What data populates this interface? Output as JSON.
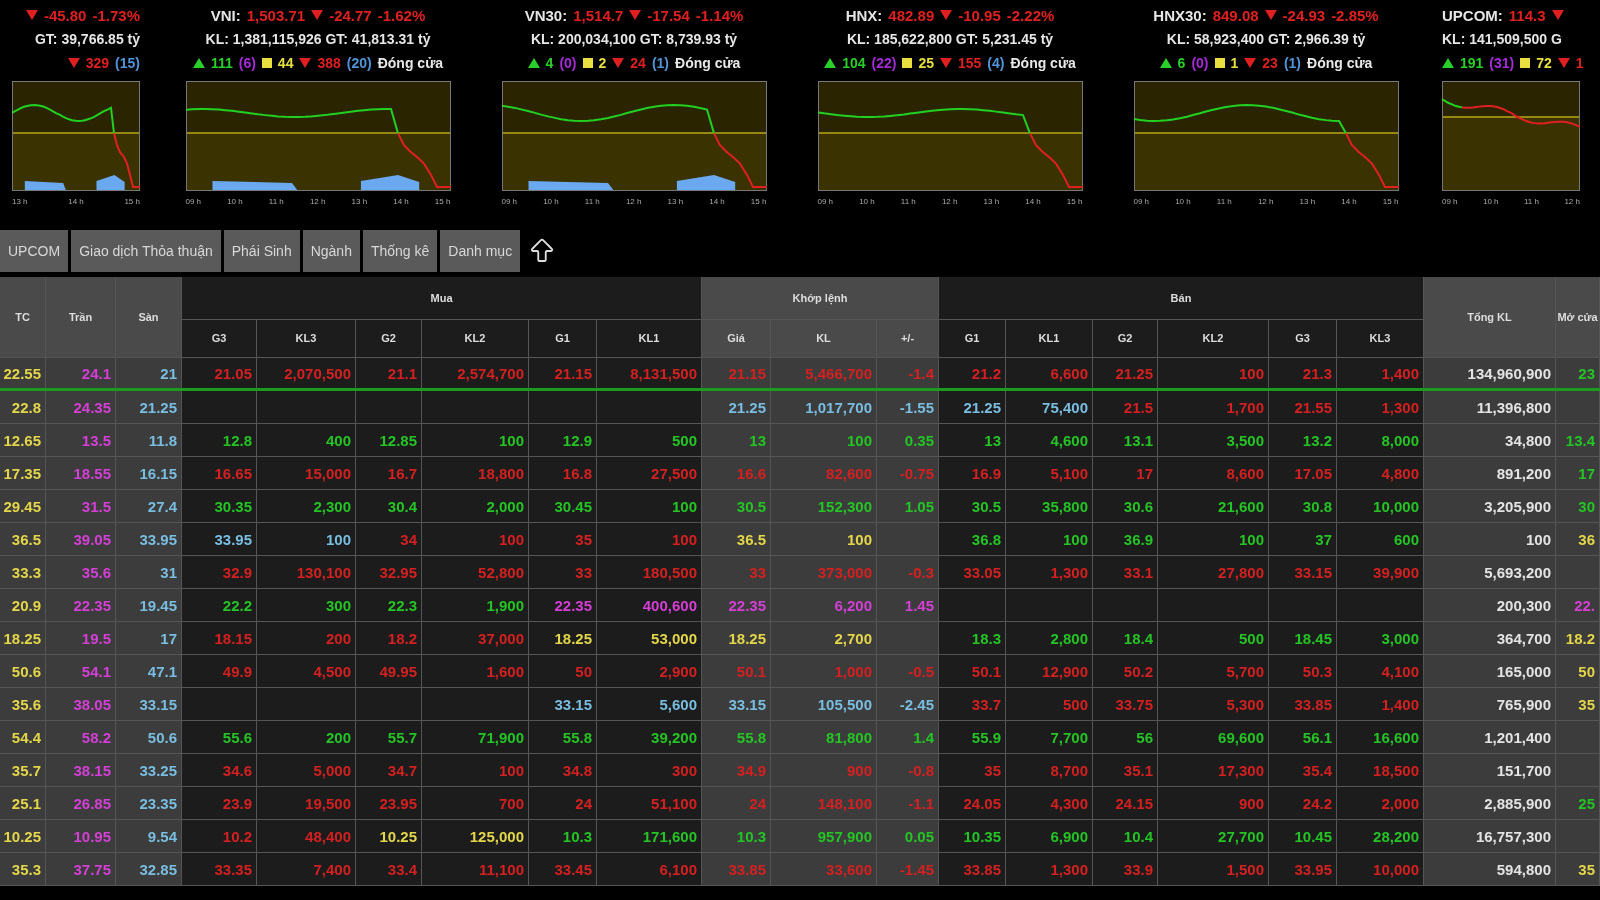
{
  "indices": [
    {
      "falling": true,
      "change": "-45.80",
      "percent": "-1.73%",
      "volume": "GT: 39,766.85 tỷ",
      "counts": [
        {
          "kind": "down",
          "text": "329"
        },
        {
          "kind": "floor",
          "text": "(15)"
        }
      ],
      "ticks": [
        "13 h",
        "14 h",
        "15 h"
      ]
    },
    {
      "name": "VNI:",
      "value": "1,503.71",
      "falling": true,
      "change": "-24.77",
      "percent": "-1.62%",
      "volume": "KL: 1,381,115,926 GT: 41,813.31 tỷ",
      "counts": [
        {
          "kind": "up",
          "text": "111"
        },
        {
          "kind": "ceil",
          "text": "(6)"
        },
        {
          "kind": "ref",
          "text": "44"
        },
        {
          "kind": "down",
          "text": "388"
        },
        {
          "kind": "floor",
          "text": "(20)"
        },
        {
          "kind": "status",
          "text": "Đóng cửa"
        }
      ],
      "ticks": [
        "09 h",
        "10 h",
        "11 h",
        "12 h",
        "13 h",
        "14 h",
        "15 h"
      ]
    },
    {
      "name": "VN30:",
      "value": "1,514.7",
      "falling": true,
      "change": "-17.54",
      "percent": "-1.14%",
      "volume": "KL: 200,034,100 GT: 8,739.93 tỷ",
      "counts": [
        {
          "kind": "up",
          "text": "4"
        },
        {
          "kind": "ceil",
          "text": "(0)"
        },
        {
          "kind": "ref",
          "text": "2"
        },
        {
          "kind": "down",
          "text": "24"
        },
        {
          "kind": "floor",
          "text": "(1)"
        },
        {
          "kind": "status",
          "text": "Đóng cửa"
        }
      ],
      "ticks": [
        "09 h",
        "10 h",
        "11 h",
        "12 h",
        "13 h",
        "14 h",
        "15 h"
      ]
    },
    {
      "name": "HNX:",
      "value": "482.89",
      "falling": true,
      "change": "-10.95",
      "percent": "-2.22%",
      "volume": "KL: 185,622,800 GT: 5,231.45 tỷ",
      "counts": [
        {
          "kind": "up",
          "text": "104"
        },
        {
          "kind": "ceil",
          "text": "(22)"
        },
        {
          "kind": "ref",
          "text": "25"
        },
        {
          "kind": "down",
          "text": "155"
        },
        {
          "kind": "floor",
          "text": "(4)"
        },
        {
          "kind": "status",
          "text": "Đóng cửa"
        }
      ],
      "ticks": [
        "09 h",
        "10 h",
        "11 h",
        "12 h",
        "13 h",
        "14 h",
        "15 h"
      ]
    },
    {
      "name": "HNX30:",
      "value": "849.08",
      "falling": true,
      "change": "-24.93",
      "percent": "-2.85%",
      "volume": "KL: 58,923,400 GT: 2,966.39 tỷ",
      "counts": [
        {
          "kind": "up",
          "text": "6"
        },
        {
          "kind": "ceil",
          "text": "(0)"
        },
        {
          "kind": "ref",
          "text": "1"
        },
        {
          "kind": "down",
          "text": "23"
        },
        {
          "kind": "floor",
          "text": "(1)"
        },
        {
          "kind": "status",
          "text": "Đóng cửa"
        }
      ],
      "ticks": [
        "09 h",
        "10 h",
        "11 h",
        "12 h",
        "13 h",
        "14 h",
        "15 h"
      ]
    },
    {
      "name": "UPCOM:",
      "value": "114.3",
      "falling": true,
      "volume": "KL: 141,509,500 G",
      "counts": [
        {
          "kind": "up",
          "text": "191"
        },
        {
          "kind": "ceil",
          "text": "(31)"
        },
        {
          "kind": "ref",
          "text": "72"
        },
        {
          "kind": "down",
          "text": "1"
        }
      ],
      "ticks": [
        "09 h",
        "10 h",
        "11 h",
        "12 h"
      ]
    }
  ],
  "tabs": [
    "UPCOM",
    "Giao dịch Thỏa thuận",
    "Phái Sinh",
    "Ngành",
    "Thống kê",
    "Danh mục"
  ],
  "table": {
    "header": [
      {
        "label": "TC"
      },
      {
        "label": "Trần"
      },
      {
        "label": "Sàn"
      },
      {
        "label": "Mua",
        "columns": [
          "G3",
          "KL3",
          "G2",
          "KL2",
          "G1",
          "KL1"
        ]
      },
      {
        "label": "Khớp lệnh",
        "columns": [
          "Giá",
          "KL",
          "+/-"
        ]
      },
      {
        "label": "Bán",
        "columns": [
          "G1",
          "KL1",
          "G2",
          "KL2",
          "G3",
          "KL3"
        ]
      },
      {
        "label": "Tổng KL"
      },
      {
        "label": "Mở cửa"
      }
    ],
    "rows": [
      {
        "selected": true,
        "cells": [
          {
            "text": "22.55",
            "kind": "ref"
          },
          {
            "text": "24.1",
            "kind": "ceil"
          },
          {
            "text": "21",
            "kind": "floor"
          },
          {
            "text": "21.05",
            "kind": "down"
          },
          {
            "text": "2,070,500",
            "kind": "down"
          },
          {
            "text": "21.1",
            "kind": "down"
          },
          {
            "text": "2,574,700",
            "kind": "down"
          },
          {
            "text": "21.15",
            "kind": "down"
          },
          {
            "text": "8,131,500",
            "kind": "down"
          },
          {
            "text": "21.15",
            "kind": "down"
          },
          {
            "text": "5,466,700",
            "kind": "down"
          },
          {
            "text": "-1.4",
            "kind": "down"
          },
          {
            "text": "21.2",
            "kind": "down"
          },
          {
            "text": "6,600",
            "kind": "down"
          },
          {
            "text": "21.25",
            "kind": "down"
          },
          {
            "text": "100",
            "kind": "down"
          },
          {
            "text": "21.3",
            "kind": "down"
          },
          {
            "text": "1,400",
            "kind": "down"
          },
          {
            "text": "134,960,900",
            "kind": "white"
          },
          {
            "text": "23",
            "kind": "up"
          }
        ]
      },
      {
        "selected": false,
        "cells": [
          {
            "text": "22.8",
            "kind": "ref"
          },
          {
            "text": "24.35",
            "kind": "ceil"
          },
          {
            "text": "21.25",
            "kind": "floor"
          },
          {
            "kind": "empty"
          },
          {
            "kind": "empty"
          },
          {
            "kind": "empty"
          },
          {
            "kind": "empty"
          },
          {
            "kind": "empty"
          },
          {
            "kind": "empty"
          },
          {
            "text": "21.25",
            "kind": "floor"
          },
          {
            "text": "1,017,700",
            "kind": "floor"
          },
          {
            "text": "-1.55",
            "kind": "floor"
          },
          {
            "text": "21.25",
            "kind": "floor"
          },
          {
            "text": "75,400",
            "kind": "floor"
          },
          {
            "text": "21.5",
            "kind": "down"
          },
          {
            "text": "1,700",
            "kind": "down"
          },
          {
            "text": "21.55",
            "kind": "down"
          },
          {
            "text": "1,300",
            "kind": "down"
          },
          {
            "text": "11,396,800",
            "kind": "white"
          },
          {
            "kind": "empty"
          }
        ]
      },
      {
        "selected": false,
        "cells": [
          {
            "text": "12.65",
            "kind": "ref"
          },
          {
            "text": "13.5",
            "kind": "ceil"
          },
          {
            "text": "11.8",
            "kind": "floor"
          },
          {
            "text": "12.8",
            "kind": "up"
          },
          {
            "text": "400",
            "kind": "up"
          },
          {
            "text": "12.85",
            "kind": "up"
          },
          {
            "text": "100",
            "kind": "up"
          },
          {
            "text": "12.9",
            "kind": "up"
          },
          {
            "text": "500",
            "kind": "up"
          },
          {
            "text": "13",
            "kind": "up"
          },
          {
            "text": "100",
            "kind": "up"
          },
          {
            "text": "0.35",
            "kind": "up"
          },
          {
            "text": "13",
            "kind": "up"
          },
          {
            "text": "4,600",
            "kind": "up"
          },
          {
            "text": "13.1",
            "kind": "up"
          },
          {
            "text": "3,500",
            "kind": "up"
          },
          {
            "text": "13.2",
            "kind": "up"
          },
          {
            "text": "8,000",
            "kind": "up"
          },
          {
            "text": "34,800",
            "kind": "white"
          },
          {
            "text": "13.4",
            "kind": "up"
          }
        ]
      },
      {
        "selected": false,
        "cells": [
          {
            "text": "17.35",
            "kind": "ref"
          },
          {
            "text": "18.55",
            "kind": "ceil"
          },
          {
            "text": "16.15",
            "kind": "floor"
          },
          {
            "text": "16.65",
            "kind": "down"
          },
          {
            "text": "15,000",
            "kind": "down"
          },
          {
            "text": "16.7",
            "kind": "down"
          },
          {
            "text": "18,800",
            "kind": "down"
          },
          {
            "text": "16.8",
            "kind": "down"
          },
          {
            "text": "27,500",
            "kind": "down"
          },
          {
            "text": "16.6",
            "kind": "down"
          },
          {
            "text": "82,600",
            "kind": "down"
          },
          {
            "text": "-0.75",
            "kind": "down"
          },
          {
            "text": "16.9",
            "kind": "down"
          },
          {
            "text": "5,100",
            "kind": "down"
          },
          {
            "text": "17",
            "kind": "down"
          },
          {
            "text": "8,600",
            "kind": "down"
          },
          {
            "text": "17.05",
            "kind": "down"
          },
          {
            "text": "4,800",
            "kind": "down"
          },
          {
            "text": "891,200",
            "kind": "white"
          },
          {
            "text": "17",
            "kind": "up"
          }
        ]
      },
      {
        "selected": false,
        "cells": [
          {
            "text": "29.45",
            "kind": "ref"
          },
          {
            "text": "31.5",
            "kind": "ceil"
          },
          {
            "text": "27.4",
            "kind": "floor"
          },
          {
            "text": "30.35",
            "kind": "up"
          },
          {
            "text": "2,300",
            "kind": "up"
          },
          {
            "text": "30.4",
            "kind": "up"
          },
          {
            "text": "2,000",
            "kind": "up"
          },
          {
            "text": "30.45",
            "kind": "up"
          },
          {
            "text": "100",
            "kind": "up"
          },
          {
            "text": "30.5",
            "kind": "up"
          },
          {
            "text": "152,300",
            "kind": "up"
          },
          {
            "text": "1.05",
            "kind": "up"
          },
          {
            "text": "30.5",
            "kind": "up"
          },
          {
            "text": "35,800",
            "kind": "up"
          },
          {
            "text": "30.6",
            "kind": "up"
          },
          {
            "text": "21,600",
            "kind": "up"
          },
          {
            "text": "30.8",
            "kind": "up"
          },
          {
            "text": "10,000",
            "kind": "up"
          },
          {
            "text": "3,205,900",
            "kind": "white"
          },
          {
            "text": "30",
            "kind": "up"
          }
        ]
      },
      {
        "selected": false,
        "cells": [
          {
            "text": "36.5",
            "kind": "ref"
          },
          {
            "text": "39.05",
            "kind": "ceil"
          },
          {
            "text": "33.95",
            "kind": "floor"
          },
          {
            "text": "33.95",
            "kind": "floor"
          },
          {
            "text": "100",
            "kind": "floor"
          },
          {
            "text": "34",
            "kind": "down"
          },
          {
            "text": "100",
            "kind": "down"
          },
          {
            "text": "35",
            "kind": "down"
          },
          {
            "text": "100",
            "kind": "down"
          },
          {
            "text": "36.5",
            "kind": "ref"
          },
          {
            "text": "100",
            "kind": "ref"
          },
          {
            "kind": "empty"
          },
          {
            "text": "36.8",
            "kind": "up"
          },
          {
            "text": "100",
            "kind": "up"
          },
          {
            "text": "36.9",
            "kind": "up"
          },
          {
            "text": "100",
            "kind": "up"
          },
          {
            "text": "37",
            "kind": "up"
          },
          {
            "text": "600",
            "kind": "up"
          },
          {
            "text": "100",
            "kind": "white"
          },
          {
            "text": "36",
            "kind": "ref"
          }
        ]
      },
      {
        "selected": false,
        "cells": [
          {
            "text": "33.3",
            "kind": "ref"
          },
          {
            "text": "35.6",
            "kind": "ceil"
          },
          {
            "text": "31",
            "kind": "floor"
          },
          {
            "text": "32.9",
            "kind": "down"
          },
          {
            "text": "130,100",
            "kind": "down"
          },
          {
            "text": "32.95",
            "kind": "down"
          },
          {
            "text": "52,800",
            "kind": "down"
          },
          {
            "text": "33",
            "kind": "down"
          },
          {
            "text": "180,500",
            "kind": "down"
          },
          {
            "text": "33",
            "kind": "down"
          },
          {
            "text": "373,000",
            "kind": "down"
          },
          {
            "text": "-0.3",
            "kind": "down"
          },
          {
            "text": "33.05",
            "kind": "down"
          },
          {
            "text": "1,300",
            "kind": "down"
          },
          {
            "text": "33.1",
            "kind": "down"
          },
          {
            "text": "27,800",
            "kind": "down"
          },
          {
            "text": "33.15",
            "kind": "down"
          },
          {
            "text": "39,900",
            "kind": "down"
          },
          {
            "text": "5,693,200",
            "kind": "white"
          },
          {
            "kind": "empty"
          }
        ]
      },
      {
        "selected": false,
        "cells": [
          {
            "text": "20.9",
            "kind": "ref"
          },
          {
            "text": "22.35",
            "kind": "ceil"
          },
          {
            "text": "19.45",
            "kind": "floor"
          },
          {
            "text": "22.2",
            "kind": "up"
          },
          {
            "text": "300",
            "kind": "up"
          },
          {
            "text": "22.3",
            "kind": "up"
          },
          {
            "text": "1,900",
            "kind": "up"
          },
          {
            "text": "22.35",
            "kind": "ceil"
          },
          {
            "text": "400,600",
            "kind": "ceil"
          },
          {
            "text": "22.35",
            "kind": "ceil"
          },
          {
            "text": "6,200",
            "kind": "ceil"
          },
          {
            "text": "1.45",
            "kind": "ceil"
          },
          {
            "kind": "empty"
          },
          {
            "kind": "empty"
          },
          {
            "kind": "empty"
          },
          {
            "kind": "empty"
          },
          {
            "kind": "empty"
          },
          {
            "kind": "empty"
          },
          {
            "text": "200,300",
            "kind": "white"
          },
          {
            "text": "22.",
            "kind": "ceil"
          }
        ]
      },
      {
        "selected": false,
        "cells": [
          {
            "text": "18.25",
            "kind": "ref"
          },
          {
            "text": "19.5",
            "kind": "ceil"
          },
          {
            "text": "17",
            "kind": "floor"
          },
          {
            "text": "18.15",
            "kind": "down"
          },
          {
            "text": "200",
            "kind": "down"
          },
          {
            "text": "18.2",
            "kind": "down"
          },
          {
            "text": "37,000",
            "kind": "down"
          },
          {
            "text": "18.25",
            "kind": "ref"
          },
          {
            "text": "53,000",
            "kind": "ref"
          },
          {
            "text": "18.25",
            "kind": "ref"
          },
          {
            "text": "2,700",
            "kind": "ref"
          },
          {
            "kind": "empty"
          },
          {
            "text": "18.3",
            "kind": "up"
          },
          {
            "text": "2,800",
            "kind": "up"
          },
          {
            "text": "18.4",
            "kind": "up"
          },
          {
            "text": "500",
            "kind": "up"
          },
          {
            "text": "18.45",
            "kind": "up"
          },
          {
            "text": "3,000",
            "kind": "up"
          },
          {
            "text": "364,700",
            "kind": "white"
          },
          {
            "text": "18.2",
            "kind": "ref"
          }
        ]
      },
      {
        "selected": false,
        "cells": [
          {
            "text": "50.6",
            "kind": "ref"
          },
          {
            "text": "54.1",
            "kind": "ceil"
          },
          {
            "text": "47.1",
            "kind": "floor"
          },
          {
            "text": "49.9",
            "kind": "down"
          },
          {
            "text": "4,500",
            "kind": "down"
          },
          {
            "text": "49.95",
            "kind": "down"
          },
          {
            "text": "1,600",
            "kind": "down"
          },
          {
            "text": "50",
            "kind": "down"
          },
          {
            "text": "2,900",
            "kind": "down"
          },
          {
            "text": "50.1",
            "kind": "down"
          },
          {
            "text": "1,000",
            "kind": "down"
          },
          {
            "text": "-0.5",
            "kind": "down"
          },
          {
            "text": "50.1",
            "kind": "down"
          },
          {
            "text": "12,900",
            "kind": "down"
          },
          {
            "text": "50.2",
            "kind": "down"
          },
          {
            "text": "5,700",
            "kind": "down"
          },
          {
            "text": "50.3",
            "kind": "down"
          },
          {
            "text": "4,100",
            "kind": "down"
          },
          {
            "text": "165,000",
            "kind": "white"
          },
          {
            "text": "50",
            "kind": "ref"
          }
        ]
      },
      {
        "selected": false,
        "cells": [
          {
            "text": "35.6",
            "kind": "ref"
          },
          {
            "text": "38.05",
            "kind": "ceil"
          },
          {
            "text": "33.15",
            "kind": "floor"
          },
          {
            "kind": "empty"
          },
          {
            "kind": "empty"
          },
          {
            "kind": "empty"
          },
          {
            "kind": "empty"
          },
          {
            "text": "33.15",
            "kind": "floor"
          },
          {
            "text": "5,600",
            "kind": "floor"
          },
          {
            "text": "33.15",
            "kind": "floor"
          },
          {
            "text": "105,500",
            "kind": "floor"
          },
          {
            "text": "-2.45",
            "kind": "floor"
          },
          {
            "text": "33.7",
            "kind": "down"
          },
          {
            "text": "500",
            "kind": "down"
          },
          {
            "text": "33.75",
            "kind": "down"
          },
          {
            "text": "5,300",
            "kind": "down"
          },
          {
            "text": "33.85",
            "kind": "down"
          },
          {
            "text": "1,400",
            "kind": "down"
          },
          {
            "text": "765,900",
            "kind": "white"
          },
          {
            "text": "35",
            "kind": "ref"
          }
        ]
      },
      {
        "selected": false,
        "cells": [
          {
            "text": "54.4",
            "kind": "ref"
          },
          {
            "text": "58.2",
            "kind": "ceil"
          },
          {
            "text": "50.6",
            "kind": "floor"
          },
          {
            "text": "55.6",
            "kind": "up"
          },
          {
            "text": "200",
            "kind": "up"
          },
          {
            "text": "55.7",
            "kind": "up"
          },
          {
            "text": "71,900",
            "kind": "up"
          },
          {
            "text": "55.8",
            "kind": "up"
          },
          {
            "text": "39,200",
            "kind": "up"
          },
          {
            "text": "55.8",
            "kind": "up"
          },
          {
            "text": "81,800",
            "kind": "up"
          },
          {
            "text": "1.4",
            "kind": "up"
          },
          {
            "text": "55.9",
            "kind": "up"
          },
          {
            "text": "7,700",
            "kind": "up"
          },
          {
            "text": "56",
            "kind": "up"
          },
          {
            "text": "69,600",
            "kind": "up"
          },
          {
            "text": "56.1",
            "kind": "up"
          },
          {
            "text": "16,600",
            "kind": "up"
          },
          {
            "text": "1,201,400",
            "kind": "white"
          },
          {
            "kind": "empty"
          }
        ]
      },
      {
        "selected": false,
        "cells": [
          {
            "text": "35.7",
            "kind": "ref"
          },
          {
            "text": "38.15",
            "kind": "ceil"
          },
          {
            "text": "33.25",
            "kind": "floor"
          },
          {
            "text": "34.6",
            "kind": "down"
          },
          {
            "text": "5,000",
            "kind": "down"
          },
          {
            "text": "34.7",
            "kind": "down"
          },
          {
            "text": "100",
            "kind": "down"
          },
          {
            "text": "34.8",
            "kind": "down"
          },
          {
            "text": "300",
            "kind": "down"
          },
          {
            "text": "34.9",
            "kind": "down"
          },
          {
            "text": "900",
            "kind": "down"
          },
          {
            "text": "-0.8",
            "kind": "down"
          },
          {
            "text": "35",
            "kind": "down"
          },
          {
            "text": "8,700",
            "kind": "down"
          },
          {
            "text": "35.1",
            "kind": "down"
          },
          {
            "text": "17,300",
            "kind": "down"
          },
          {
            "text": "35.4",
            "kind": "down"
          },
          {
            "text": "18,500",
            "kind": "down"
          },
          {
            "text": "151,700",
            "kind": "white"
          },
          {
            "kind": "empty"
          }
        ]
      },
      {
        "selected": false,
        "cells": [
          {
            "text": "25.1",
            "kind": "ref"
          },
          {
            "text": "26.85",
            "kind": "ceil"
          },
          {
            "text": "23.35",
            "kind": "floor"
          },
          {
            "text": "23.9",
            "kind": "down"
          },
          {
            "text": "19,500",
            "kind": "down"
          },
          {
            "text": "23.95",
            "kind": "down"
          },
          {
            "text": "700",
            "kind": "down"
          },
          {
            "text": "24",
            "kind": "down"
          },
          {
            "text": "51,100",
            "kind": "down"
          },
          {
            "text": "24",
            "kind": "down"
          },
          {
            "text": "148,100",
            "kind": "down"
          },
          {
            "text": "-1.1",
            "kind": "down"
          },
          {
            "text": "24.05",
            "kind": "down"
          },
          {
            "text": "4,300",
            "kind": "down"
          },
          {
            "text": "24.15",
            "kind": "down"
          },
          {
            "text": "900",
            "kind": "down"
          },
          {
            "text": "24.2",
            "kind": "down"
          },
          {
            "text": "2,000",
            "kind": "down"
          },
          {
            "text": "2,885,900",
            "kind": "white"
          },
          {
            "text": "25",
            "kind": "up"
          }
        ]
      },
      {
        "selected": false,
        "cells": [
          {
            "text": "10.25",
            "kind": "ref"
          },
          {
            "text": "10.95",
            "kind": "ceil"
          },
          {
            "text": "9.54",
            "kind": "floor"
          },
          {
            "text": "10.2",
            "kind": "down"
          },
          {
            "text": "48,400",
            "kind": "down"
          },
          {
            "text": "10.25",
            "kind": "ref"
          },
          {
            "text": "125,000",
            "kind": "ref"
          },
          {
            "text": "10.3",
            "kind": "up"
          },
          {
            "text": "171,600",
            "kind": "up"
          },
          {
            "text": "10.3",
            "kind": "up"
          },
          {
            "text": "957,900",
            "kind": "up"
          },
          {
            "text": "0.05",
            "kind": "up"
          },
          {
            "text": "10.35",
            "kind": "up"
          },
          {
            "text": "6,900",
            "kind": "up"
          },
          {
            "text": "10.4",
            "kind": "up"
          },
          {
            "text": "27,700",
            "kind": "up"
          },
          {
            "text": "10.45",
            "kind": "up"
          },
          {
            "text": "28,200",
            "kind": "up"
          },
          {
            "text": "16,757,300",
            "kind": "white"
          },
          {
            "kind": "empty"
          }
        ]
      },
      {
        "selected": false,
        "cells": [
          {
            "text": "35.3",
            "kind": "ref"
          },
          {
            "text": "37.75",
            "kind": "ceil"
          },
          {
            "text": "32.85",
            "kind": "floor"
          },
          {
            "text": "33.35",
            "kind": "down"
          },
          {
            "text": "7,400",
            "kind": "down"
          },
          {
            "text": "33.4",
            "kind": "down"
          },
          {
            "text": "11,100",
            "kind": "down"
          },
          {
            "text": "33.45",
            "kind": "down"
          },
          {
            "text": "6,100",
            "kind": "down"
          },
          {
            "text": "33.85",
            "kind": "down"
          },
          {
            "text": "33,600",
            "kind": "down"
          },
          {
            "text": "-1.45",
            "kind": "down"
          },
          {
            "text": "33.85",
            "kind": "down"
          },
          {
            "text": "1,300",
            "kind": "down"
          },
          {
            "text": "33.9",
            "kind": "down"
          },
          {
            "text": "1,500",
            "kind": "down"
          },
          {
            "text": "33.95",
            "kind": "down"
          },
          {
            "text": "10,000",
            "kind": "down"
          },
          {
            "text": "594,800",
            "kind": "white"
          },
          {
            "text": "35",
            "kind": "ref"
          }
        ]
      }
    ]
  }
}
